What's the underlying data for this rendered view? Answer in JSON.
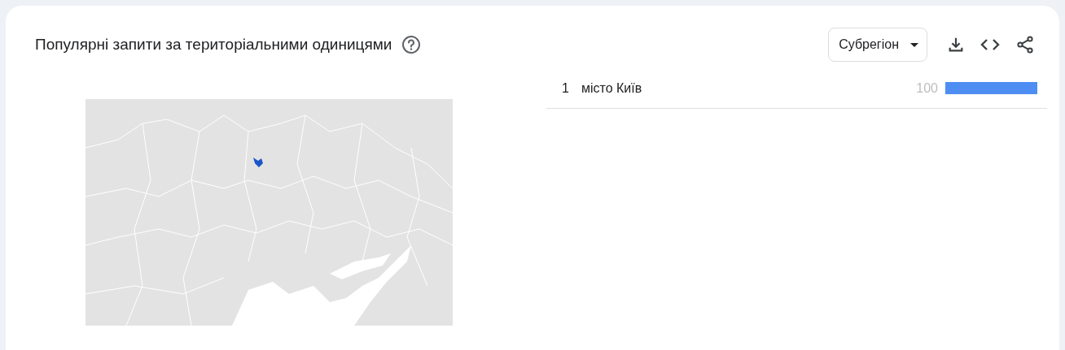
{
  "card": {
    "title": "Популярні запити за територіальними одиницями",
    "resolution_dropdown": {
      "value": "Субрегіон"
    }
  },
  "regions": [
    {
      "rank": "1",
      "name": "місто Київ",
      "value": "100",
      "level": 1
    }
  ]
}
